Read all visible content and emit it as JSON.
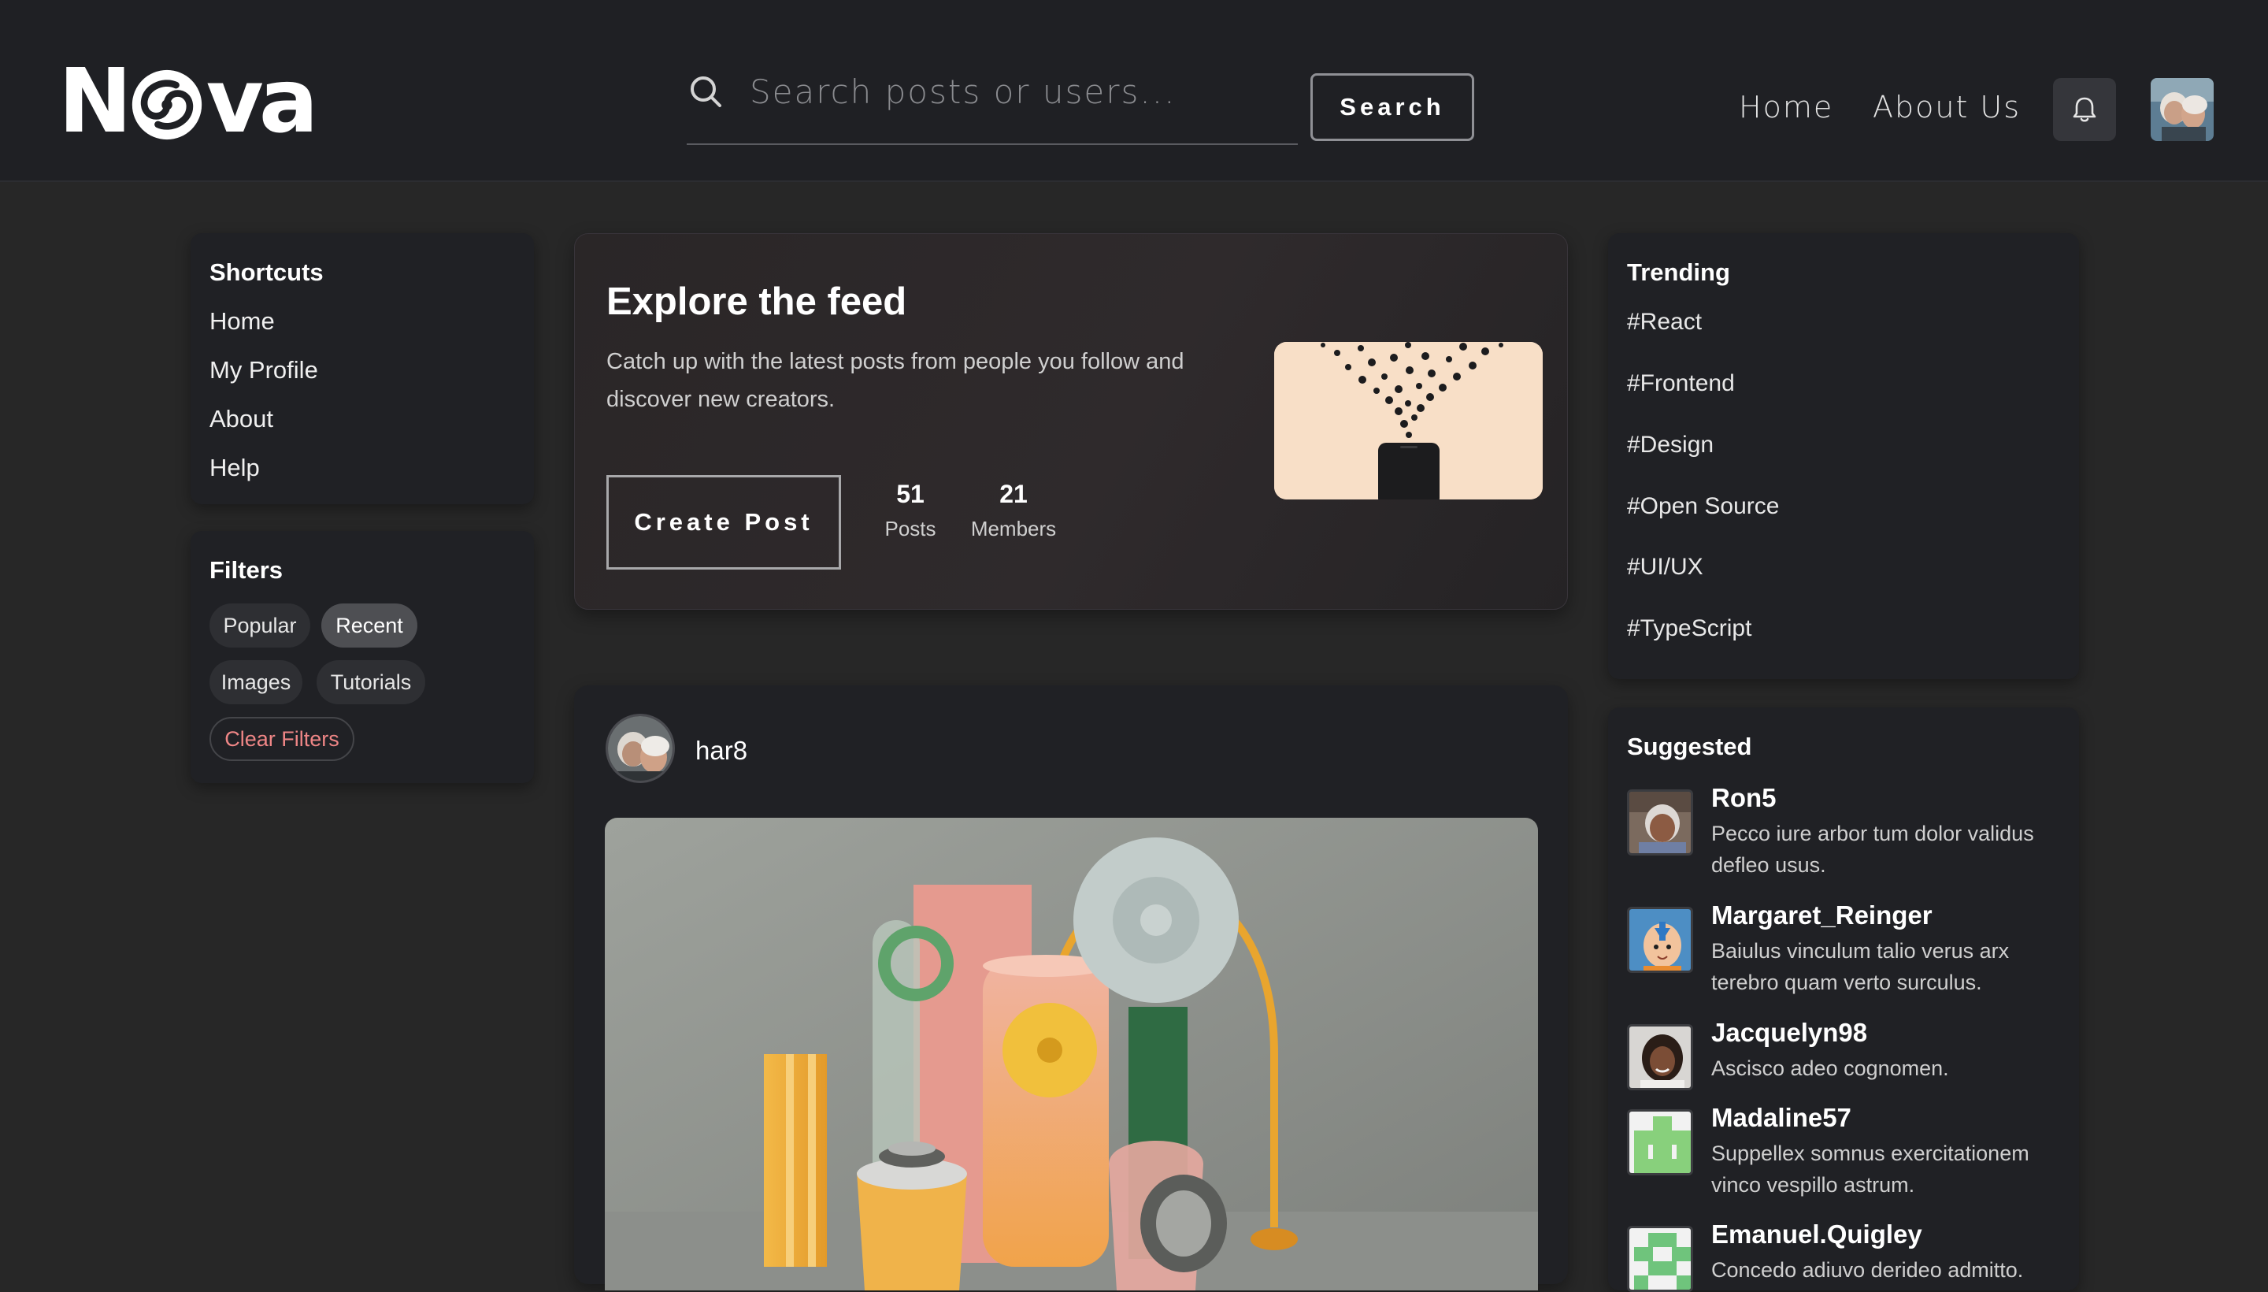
{
  "brand": {
    "name_prefix": "N",
    "name_suffix": "va"
  },
  "search": {
    "placeholder": "Search posts or users...",
    "button_label": "Search"
  },
  "nav": {
    "home": "Home",
    "about": "About Us"
  },
  "colors": {
    "bg": "#272727",
    "header": "#1f2024",
    "card": "#202125",
    "danger": "#ef8686"
  },
  "shortcuts": {
    "title": "Shortcuts",
    "items": [
      {
        "label": "Home"
      },
      {
        "label": "My Profile"
      },
      {
        "label": "About"
      },
      {
        "label": "Help"
      }
    ]
  },
  "filters": {
    "title": "Filters",
    "chips": [
      {
        "label": "Popular",
        "active": false
      },
      {
        "label": "Recent",
        "active": true
      },
      {
        "label": "Images",
        "active": false
      },
      {
        "label": "Tutorials",
        "active": false
      }
    ],
    "clear_label": "Clear Filters"
  },
  "hero": {
    "title": "Explore the feed",
    "description": "Catch up with the latest posts from people you follow and discover new creators.",
    "create_label": "Create Post",
    "stats": [
      {
        "value": "51",
        "label": "Posts"
      },
      {
        "value": "21",
        "label": "Members"
      }
    ]
  },
  "post": {
    "username": "har8"
  },
  "trending": {
    "title": "Trending",
    "tags": [
      "#React",
      "#Frontend",
      "#Design",
      "#Open Source",
      "#UI/UX",
      "#TypeScript"
    ]
  },
  "suggested": {
    "title": "Suggested",
    "users": [
      {
        "name": "Ron5",
        "bio": "Pecco iure arbor tum dolor validus defleo usus."
      },
      {
        "name": "Margaret_Reinger",
        "bio": "Baiulus vinculum talio verus arx terebro quam verto surculus."
      },
      {
        "name": "Jacquelyn98",
        "bio": "Ascisco adeo cognomen."
      },
      {
        "name": "Madaline57",
        "bio": "Suppellex somnus exercitationem vinco vespillo astrum."
      },
      {
        "name": "Emanuel.Quigley",
        "bio": "Concedo adiuvo derideo admitto."
      }
    ]
  }
}
